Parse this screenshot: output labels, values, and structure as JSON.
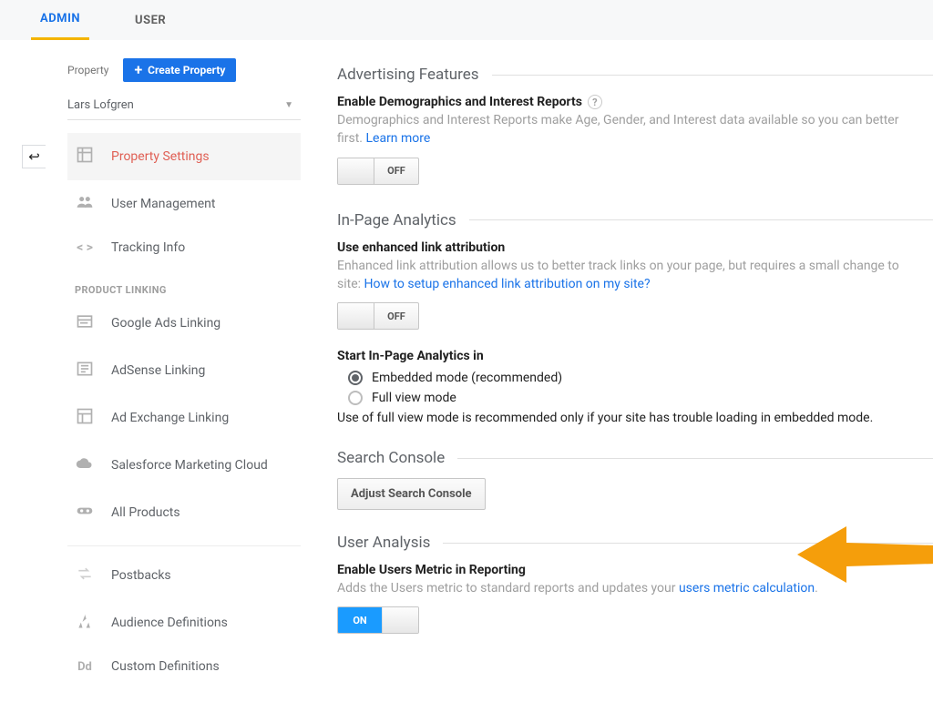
{
  "tabs": {
    "admin": "ADMIN",
    "user": "USER"
  },
  "sidebar": {
    "property_label": "Property",
    "create_button": "Create Property",
    "selected_property": "Lars Lofgren",
    "items": {
      "property_settings": "Property Settings",
      "user_management": "User Management",
      "tracking_info": "Tracking Info",
      "section_product_linking": "PRODUCT LINKING",
      "google_ads": "Google Ads Linking",
      "adsense": "AdSense Linking",
      "ad_exchange": "Ad Exchange Linking",
      "sfmc": "Salesforce Marketing Cloud",
      "all_products": "All Products",
      "postbacks": "Postbacks",
      "audience_defs": "Audience Definitions",
      "custom_defs": "Custom Definitions"
    }
  },
  "content": {
    "adv_features": {
      "heading": "Advertising Features",
      "sub": "Enable Demographics and Interest Reports",
      "help1": "Demographics and Interest Reports make Age, Gender, and Interest data available so you can better",
      "help2": "first.",
      "learn_more": "Learn more",
      "toggle": "OFF"
    },
    "inpage": {
      "heading": "In-Page Analytics",
      "sub": "Use enhanced link attribution",
      "help_a": "Enhanced link attribution allows us to better track links on your page, but requires a small change to",
      "help_b": "site:",
      "help_link": "How to setup enhanced link attribution on my site?",
      "toggle": "OFF",
      "start_label": "Start In-Page Analytics in",
      "radio1": "Embedded mode (recommended)",
      "radio2": "Full view mode",
      "note": "Use of full view mode is recommended only if your site has trouble loading in embedded mode."
    },
    "search_console": {
      "heading": "Search Console",
      "button": "Adjust Search Console"
    },
    "user_analysis": {
      "heading": "User Analysis",
      "sub": "Enable Users Metric in Reporting",
      "help_a": "Adds the Users metric to standard reports and updates your",
      "help_link": "users metric calculation",
      "toggle": "ON"
    }
  }
}
